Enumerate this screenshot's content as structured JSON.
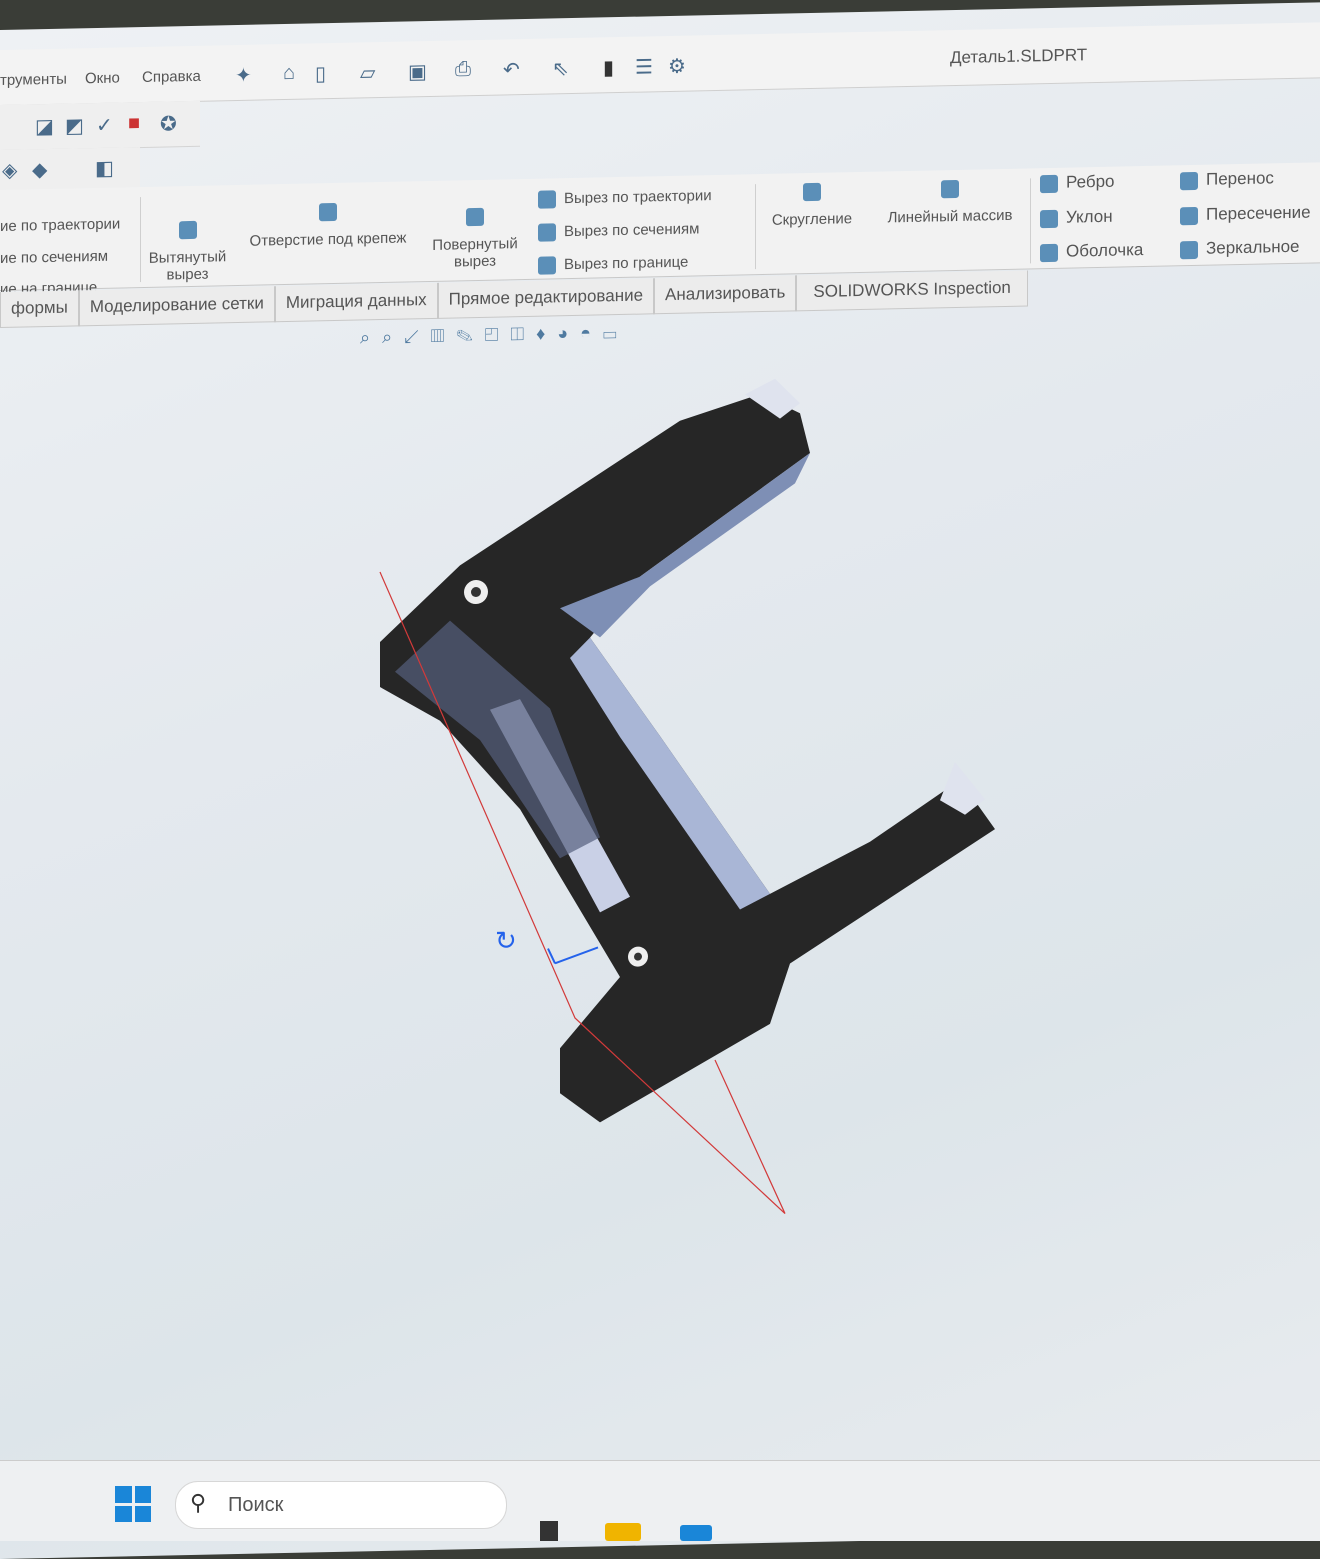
{
  "window": {
    "title": "Деталь1.SLDPRT"
  },
  "menu": [
    "трументы",
    "Окно",
    "Справка"
  ],
  "ribbon": {
    "left_partial": [
      "ие по траектории",
      "ие по сечениям",
      "ие на границе"
    ],
    "extruded_cut": "Вытянутый вырез",
    "hole_wizard": "Отверстие под крепеж",
    "revolved_cut": "Повернутый вырез",
    "swept_cut": "Вырез по траектории",
    "lofted_cut": "Вырез по сечениям",
    "boundary_cut": "Вырез по границе",
    "fillet": "Скругление",
    "linear_pattern": "Линейный массив",
    "rib": "Ребро",
    "draft": "Уклон",
    "shell": "Оболочка",
    "wrap": "Перенос",
    "intersect": "Пересечение",
    "mirror": "Зеркальное"
  },
  "tabs": [
    "формы",
    "Моделирование сетки",
    "Миграция данных",
    "Прямое редактирование",
    "Анализировать",
    "SOLIDWORKS Inspection"
  ],
  "taskbar": {
    "search_placeholder": "Поиск"
  }
}
